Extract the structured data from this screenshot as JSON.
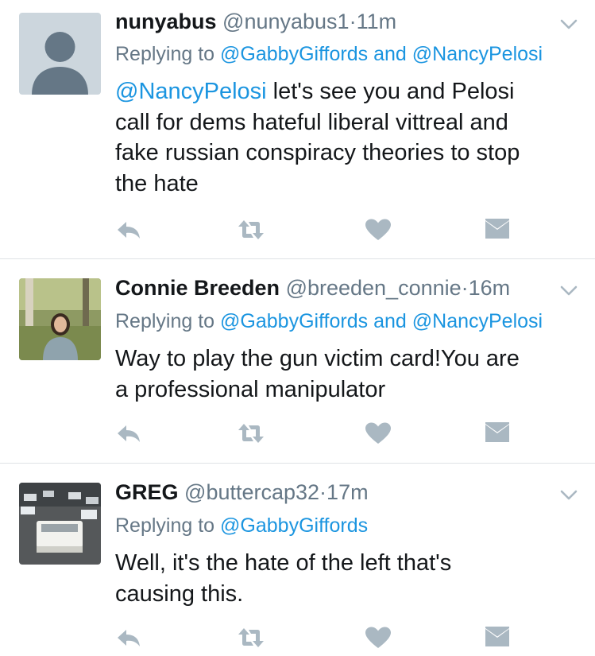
{
  "tweets": [
    {
      "name": "nunyabus",
      "handle": "@nunyabus1",
      "dot": "·",
      "time": "11m",
      "replying_prefix": "Replying to",
      "replying_mentions": [
        "@GabbyGiffords",
        "and",
        "@NancyPelosi"
      ],
      "body_mention": "@NancyPelosi",
      "body_lines": [
        " let's see you and Pelosi",
        "call for dems hateful liberal vittreal and",
        "fake russian conspiracy theories to stop",
        "the hate"
      ]
    },
    {
      "name": "Connie Breeden",
      "handle": "@breeden_connie",
      "dot": "·",
      "time": "16m",
      "replying_prefix": "Replying to",
      "replying_mentions": [
        "@GabbyGiffords",
        "and",
        "@NancyPelosi"
      ],
      "body_lines": [
        "Way to play the gun victim card!You are",
        "a professional manipulator"
      ]
    },
    {
      "name": "GREG",
      "handle": "@buttercap32",
      "dot": "·",
      "time": "17m",
      "replying_prefix": "Replying to",
      "replying_mentions": [
        "@GabbyGiffords"
      ],
      "body_lines": [
        "Well, it's the hate of the left that's",
        "causing this."
      ]
    }
  ],
  "icons": {
    "reply": "reply-icon",
    "retweet": "retweet-icon",
    "like": "heart-icon",
    "dm": "envelope-icon",
    "menu": "chevron-down-icon"
  },
  "colors": {
    "link": "#1b95e0",
    "secondary": "#657786",
    "icon": "#aab8c2",
    "divider": "#dfe3e6"
  }
}
